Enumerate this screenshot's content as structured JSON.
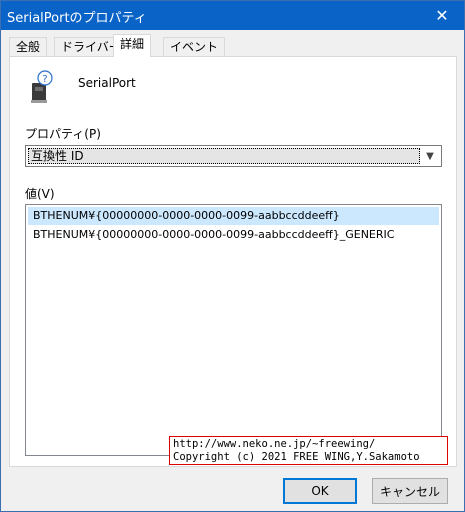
{
  "window": {
    "title": "SerialPortのプロパティ"
  },
  "tabs": [
    {
      "label": "全般"
    },
    {
      "label": "ドライバー"
    },
    {
      "label": "詳細"
    },
    {
      "label": "イベント"
    }
  ],
  "device": {
    "name": "SerialPort",
    "icon": "device-question-icon"
  },
  "property": {
    "label": "プロパティ(P)",
    "selected": "互換性 ID"
  },
  "values": {
    "label": "値(V)",
    "items": [
      "BTHENUM¥{00000000-0000-0000-0099-aabbccddeeff}",
      "BTHENUM¥{00000000-0000-0000-0099-aabbccddeeff}_GENERIC"
    ]
  },
  "watermark": {
    "line1": "http://www.neko.ne.jp/~freewing/",
    "line2": "Copyright (c) 2021 FREE WING,Y.Sakamoto"
  },
  "buttons": {
    "ok": "OK",
    "cancel": "キャンセル"
  },
  "colors": {
    "titlebar": "#0a64c8",
    "selection": "#cce8ff",
    "watermark_border": "#e00000"
  }
}
